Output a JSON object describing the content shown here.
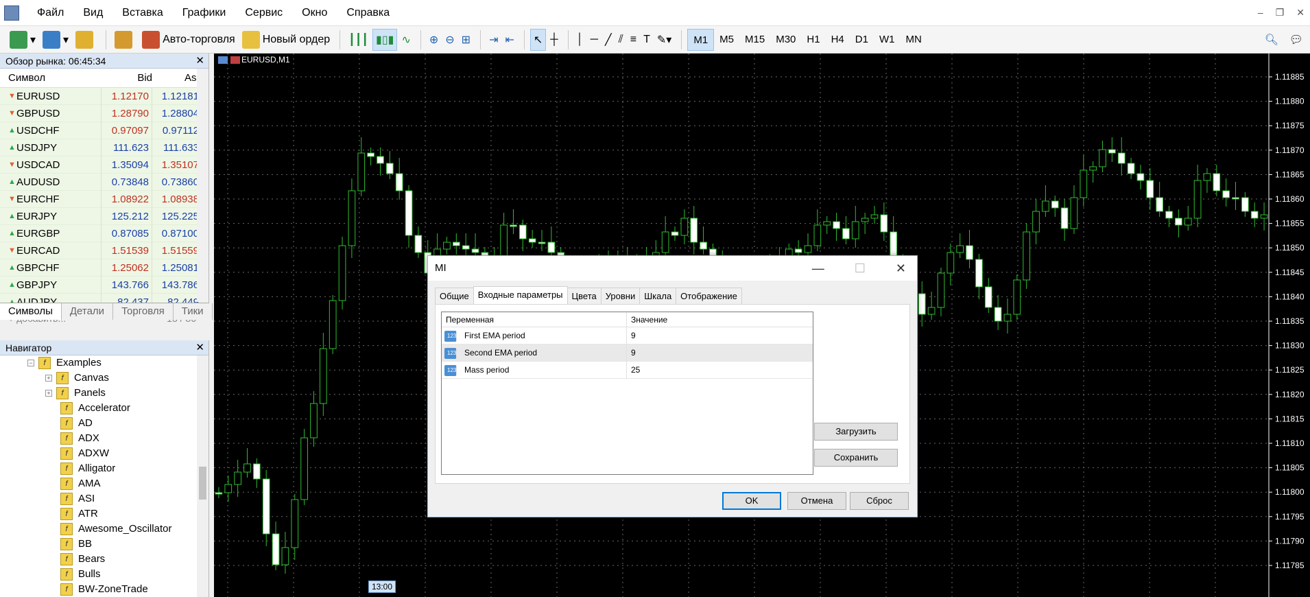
{
  "menu": [
    "Файл",
    "Вид",
    "Вставка",
    "Графики",
    "Сервис",
    "Окно",
    "Справка"
  ],
  "toolbar": {
    "auto_trading": "Авто-торговля",
    "new_order": "Новый ордер",
    "timeframes": [
      "M1",
      "M5",
      "M15",
      "M30",
      "H1",
      "H4",
      "D1",
      "W1",
      "MN"
    ],
    "active_timeframe": "M1"
  },
  "market_watch": {
    "title": "Обзор рынка: 06:45:34",
    "col_symbol": "Символ",
    "col_bid": "Bid",
    "col_ask": "Ask",
    "rows": [
      {
        "symbol": "EURUSD",
        "bid": "1.12170",
        "ask": "1.12181",
        "dir": "down",
        "bid_color": "red",
        "ask_color": "blue"
      },
      {
        "symbol": "GBPUSD",
        "bid": "1.28790",
        "ask": "1.28804",
        "dir": "down",
        "bid_color": "red",
        "ask_color": "blue"
      },
      {
        "symbol": "USDCHF",
        "bid": "0.97097",
        "ask": "0.97112",
        "dir": "up",
        "bid_color": "red",
        "ask_color": "blue"
      },
      {
        "symbol": "USDJPY",
        "bid": "111.623",
        "ask": "111.633",
        "dir": "up",
        "bid_color": "blue",
        "ask_color": "blue"
      },
      {
        "symbol": "USDCAD",
        "bid": "1.35094",
        "ask": "1.35107",
        "dir": "down",
        "bid_color": "blue",
        "ask_color": "red"
      },
      {
        "symbol": "AUDUSD",
        "bid": "0.73848",
        "ask": "0.73860",
        "dir": "up",
        "bid_color": "blue",
        "ask_color": "blue"
      },
      {
        "symbol": "EURCHF",
        "bid": "1.08922",
        "ask": "1.08938",
        "dir": "down",
        "bid_color": "red",
        "ask_color": "red"
      },
      {
        "symbol": "EURJPY",
        "bid": "125.212",
        "ask": "125.225",
        "dir": "up",
        "bid_color": "blue",
        "ask_color": "blue"
      },
      {
        "symbol": "EURGBP",
        "bid": "0.87085",
        "ask": "0.87100",
        "dir": "up",
        "bid_color": "blue",
        "ask_color": "blue"
      },
      {
        "symbol": "EURCAD",
        "bid": "1.51539",
        "ask": "1.51559",
        "dir": "down",
        "bid_color": "red",
        "ask_color": "red"
      },
      {
        "symbol": "GBPCHF",
        "bid": "1.25062",
        "ask": "1.25081",
        "dir": "up",
        "bid_color": "red",
        "ask_color": "blue"
      },
      {
        "symbol": "GBPJPY",
        "bid": "143.766",
        "ask": "143.786",
        "dir": "up",
        "bid_color": "blue",
        "ask_color": "blue"
      },
      {
        "symbol": "AUDJPY",
        "bid": "82.437",
        "ask": "82.449",
        "dir": "up",
        "bid_color": "blue",
        "ask_color": "blue"
      }
    ],
    "add_label": "добавить...",
    "count": "13 / 86",
    "tabs": [
      "Символы",
      "Детали",
      "Торговля",
      "Тики"
    ]
  },
  "navigator": {
    "title": "Навигатор",
    "folder": "Examples",
    "subfolders": [
      "Canvas",
      "Panels"
    ],
    "items": [
      "Accelerator",
      "AD",
      "ADX",
      "ADXW",
      "Alligator",
      "AMA",
      "ASI",
      "ATR",
      "Awesome_Oscillator",
      "BB",
      "Bears",
      "Bulls",
      "BW-ZoneTrade"
    ]
  },
  "chart": {
    "symbol_label": "EURUSD,M1",
    "time_label": "13:00",
    "price_levels": [
      "1.11885",
      "1.11880",
      "1.11875",
      "1.11870",
      "1.11865",
      "1.11860",
      "1.11855",
      "1.11850",
      "1.11845",
      "1.11840",
      "1.11835",
      "1.11830",
      "1.11825",
      "1.11820",
      "1.11815",
      "1.11810",
      "1.11805",
      "1.11800",
      "1.11795",
      "1.11790",
      "1.11785"
    ]
  },
  "dialog": {
    "title": "MI",
    "tabs": [
      "Общие",
      "Входные параметры",
      "Цвета",
      "Уровни",
      "Шкала",
      "Отображение"
    ],
    "active_tab": "Входные параметры",
    "col_variable": "Переменная",
    "col_value": "Значение",
    "params": [
      {
        "name": "First EMA period",
        "value": "9"
      },
      {
        "name": "Second EMA period",
        "value": "9"
      },
      {
        "name": "Mass period",
        "value": "25"
      }
    ],
    "load_button": "Загрузить",
    "save_button": "Сохранить",
    "ok_button": "OK",
    "cancel_button": "Отмена",
    "reset_button": "Сброс"
  }
}
